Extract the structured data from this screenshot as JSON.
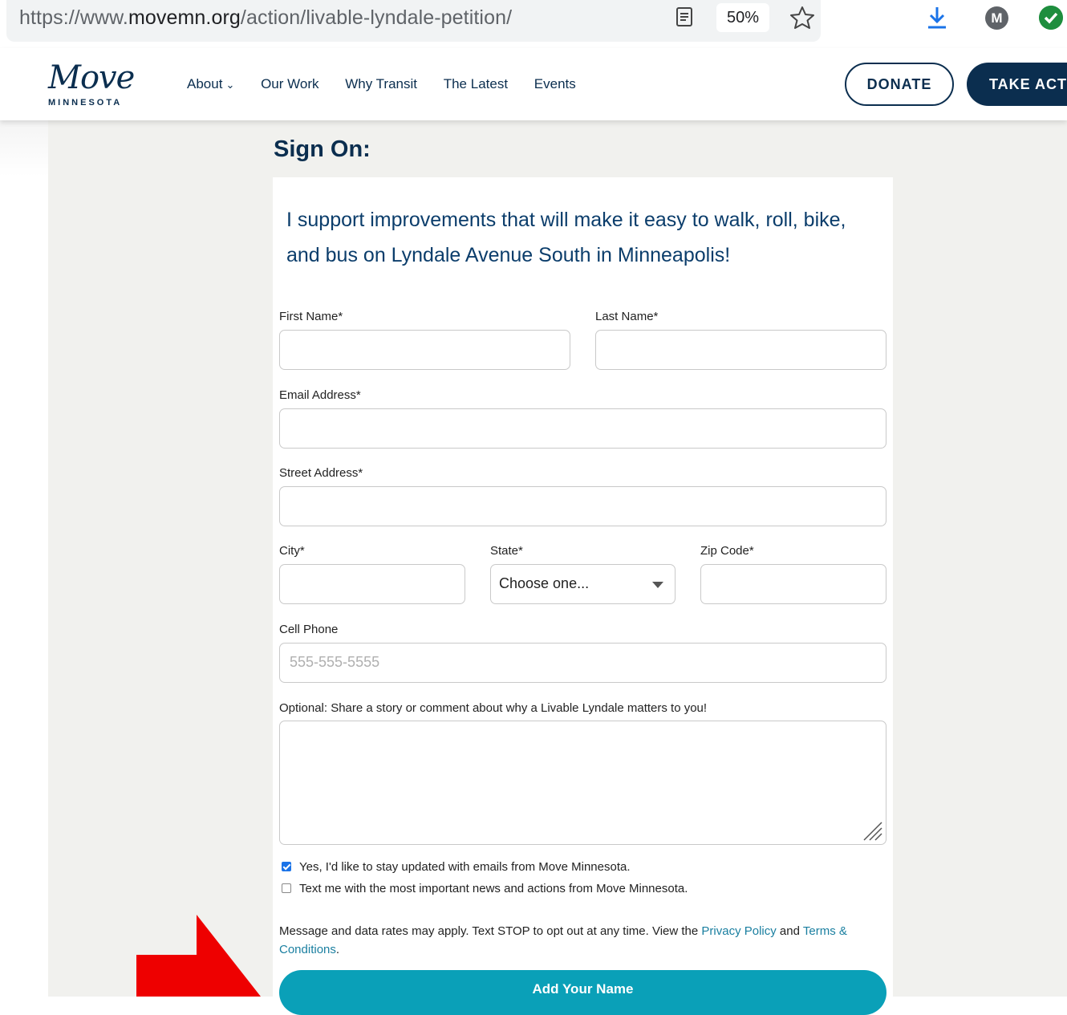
{
  "browser": {
    "url_prefix": "https://www.",
    "url_domain": "movemn.org",
    "url_path": "/action/livable-lyndale-petition/",
    "zoom": "50%",
    "profile_initial": "M"
  },
  "header": {
    "logo_text": "Move",
    "logo_sub": "MINNESOTA",
    "nav": [
      "About",
      "Our Work",
      "Why Transit",
      "The Latest",
      "Events"
    ],
    "donate_label": "DONATE",
    "take_action_label": "TAKE ACT"
  },
  "form": {
    "heading": "Sign On:",
    "pledge": "I support improvements that will make it easy to walk, roll, bike, and bus on Lyndale Avenue South in Minneapolis!",
    "first_name_label": "First Name*",
    "last_name_label": "Last Name*",
    "email_label": "Email Address*",
    "street_label": "Street Address*",
    "city_label": "City*",
    "state_label": "State*",
    "state_value": "Choose one...",
    "zip_label": "Zip Code*",
    "phone_label": "Cell Phone",
    "phone_placeholder": "555-555-5555",
    "comment_label": "Optional: Share a story or comment about why a Livable Lyndale matters to you!",
    "email_optin": {
      "label": "Yes, I'd like to stay updated with emails from Move Minnesota.",
      "checked": true
    },
    "text_optin": {
      "label": "Text me with the most important news and actions from Move Minnesota.",
      "checked": false
    },
    "disclaimer_text": "Message and data rates may apply. Text STOP to opt out at any time. View the ",
    "privacy_link": "Privacy Policy",
    "and_text": " and ",
    "terms_link": "Terms & Conditions",
    "period": ".",
    "submit_label": "Add Your Name"
  },
  "colors": {
    "brand_navy": "#0b2e4f",
    "submit_teal": "#0aa0b8",
    "arrow_red": "#ee0000"
  }
}
